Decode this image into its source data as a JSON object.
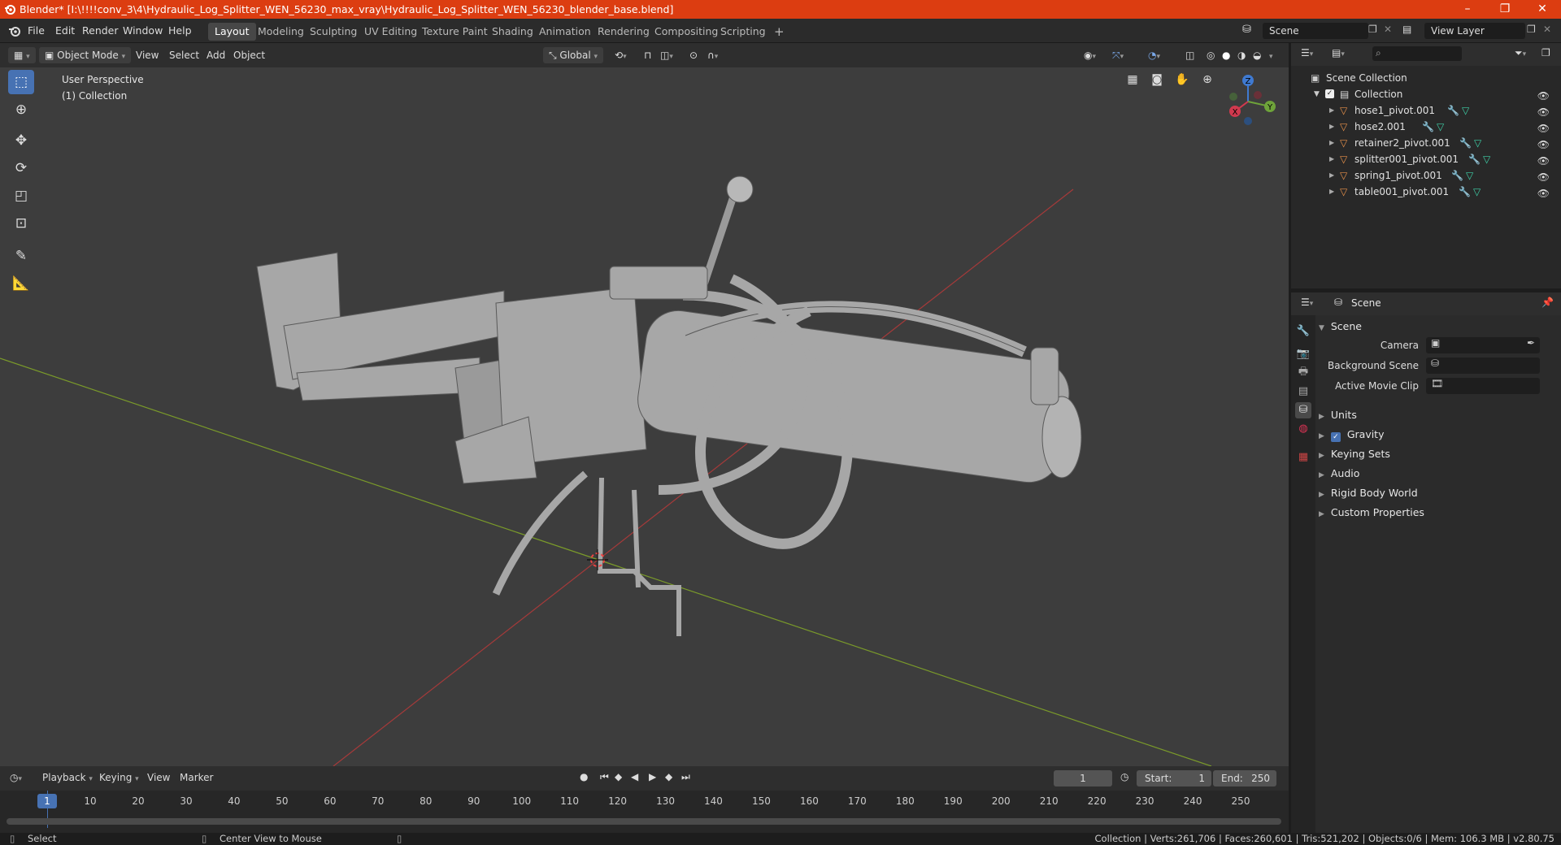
{
  "titlebar": {
    "title": "Blender* [I:\\!!!!conv_3\\4\\Hydraulic_Log_Splitter_WEN_56230_max_vray\\Hydraulic_Log_Splitter_WEN_56230_blender_base.blend]",
    "minimize": "–",
    "maximize": "❐",
    "close": "✕"
  },
  "menus": [
    "File",
    "Edit",
    "Render",
    "Window",
    "Help"
  ],
  "workspaces": [
    "Layout",
    "Modeling",
    "Sculpting",
    "UV Editing",
    "Texture Paint",
    "Shading",
    "Animation",
    "Rendering",
    "Compositing",
    "Scripting"
  ],
  "workspace_add": "+",
  "scene_field": "Scene",
  "view_layer_field": "View Layer",
  "viewport_header": {
    "mode": "Object Mode",
    "menus": [
      "View",
      "Select",
      "Add",
      "Object"
    ],
    "orientation": "Global"
  },
  "viewport": {
    "perspective": "User Perspective",
    "collection": "(1) Collection",
    "gizmo": {
      "x": "X",
      "y": "Y",
      "z": "Z"
    }
  },
  "outliner": {
    "root": "Scene Collection",
    "collection": "Collection",
    "items": [
      "hose1_pivot.001",
      "hose2.001",
      "retainer2_pivot.001",
      "splitter001_pivot.001",
      "spring1_pivot.001",
      "table001_pivot.001"
    ]
  },
  "properties": {
    "header": "Scene",
    "section": "Scene",
    "fields": [
      {
        "label": "Camera"
      },
      {
        "label": "Background Scene"
      },
      {
        "label": "Active Movie Clip"
      }
    ],
    "subsections": [
      "Units",
      "Gravity",
      "Keying Sets",
      "Audio",
      "Rigid Body World",
      "Custom Properties"
    ]
  },
  "timeline": {
    "menus": [
      "Playback",
      "Keying",
      "View",
      "Marker"
    ],
    "current_frame": "1",
    "start_label": "Start:",
    "start": "1",
    "end_label": "End:",
    "end": "250",
    "ticks": [
      "1",
      "10",
      "20",
      "30",
      "40",
      "50",
      "60",
      "70",
      "80",
      "90",
      "100",
      "110",
      "120",
      "130",
      "140",
      "150",
      "160",
      "170",
      "180",
      "190",
      "200",
      "210",
      "220",
      "230",
      "240",
      "250"
    ]
  },
  "statusbar": {
    "select": "Select",
    "center_view": "Center View to Mouse",
    "stats": "Collection | Verts:261,706 | Faces:260,601 | Tris:521,202 | Objects:0/6 | Mem: 106.3 MB | v2.80.75"
  },
  "colors": {
    "title_bar": "#dc3d11",
    "accent": "#4772b3",
    "viewport_bg": "#3d3d3d",
    "x_axis": "#a63a3a",
    "y_axis": "#7a9a2a",
    "object_orange": "#e8914a"
  }
}
